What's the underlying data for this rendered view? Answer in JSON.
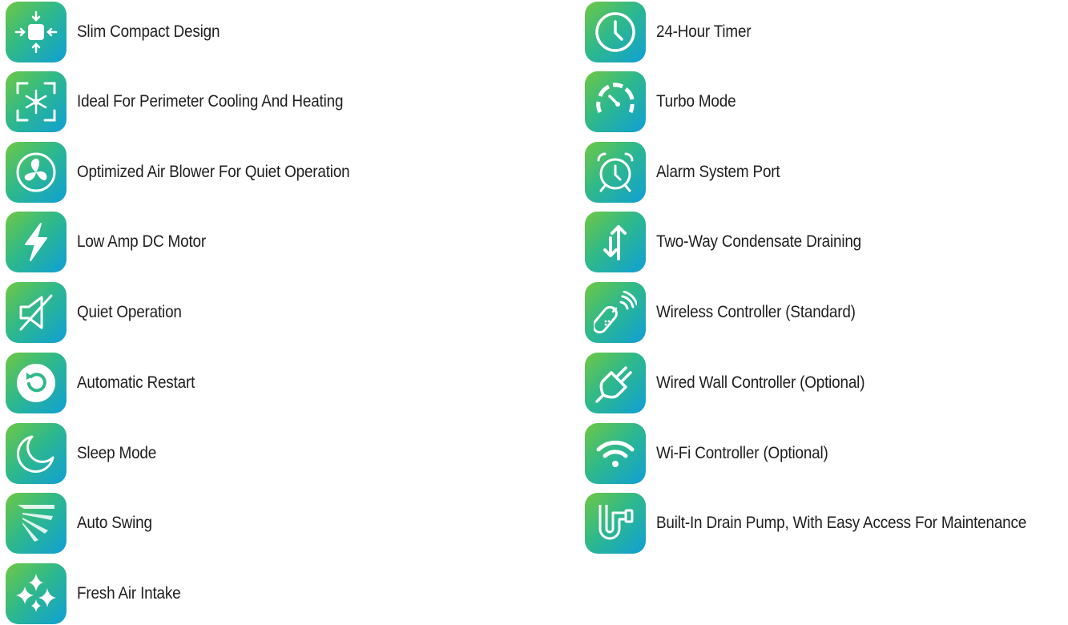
{
  "features": {
    "left": [
      {
        "label": "Slim Compact Design",
        "icon": "compact-design-icon"
      },
      {
        "label": "Ideal For Perimeter Cooling And Heating",
        "icon": "cooling-heating-icon"
      },
      {
        "label": "Optimized Air Blower For Quiet Operation",
        "icon": "fan-icon"
      },
      {
        "label": "Low Amp DC Motor",
        "icon": "lightning-bolt-icon"
      },
      {
        "label": "Quiet Operation",
        "icon": "mute-icon"
      },
      {
        "label": "Automatic Restart",
        "icon": "restart-icon"
      },
      {
        "label": "Sleep Mode",
        "icon": "moon-icon"
      },
      {
        "label": "Auto Swing",
        "icon": "swing-icon"
      },
      {
        "label": "Fresh Air Intake",
        "icon": "sparkles-icon"
      }
    ],
    "right": [
      {
        "label": "24-Hour Timer",
        "icon": "clock-icon"
      },
      {
        "label": "Turbo Mode",
        "icon": "speedometer-icon"
      },
      {
        "label": "Alarm System Port",
        "icon": "alarm-clock-icon"
      },
      {
        "label": "Two-Way Condensate Draining",
        "icon": "two-way-arrows-icon"
      },
      {
        "label": "Wireless Controller (Standard)",
        "icon": "wireless-remote-icon"
      },
      {
        "label": "Wired Wall Controller (Optional)",
        "icon": "wired-plug-icon"
      },
      {
        "label": "Wi-Fi Controller (Optional)",
        "icon": "wifi-icon"
      },
      {
        "label": "Built-In Drain Pump, With Easy Access For Maintenance",
        "icon": "drain-pipe-icon"
      }
    ]
  },
  "colors": {
    "gradient_start": "#6fc843",
    "gradient_mid": "#2fb989",
    "gradient_end": "#0f9fd6",
    "text": "#1f1f1f"
  }
}
